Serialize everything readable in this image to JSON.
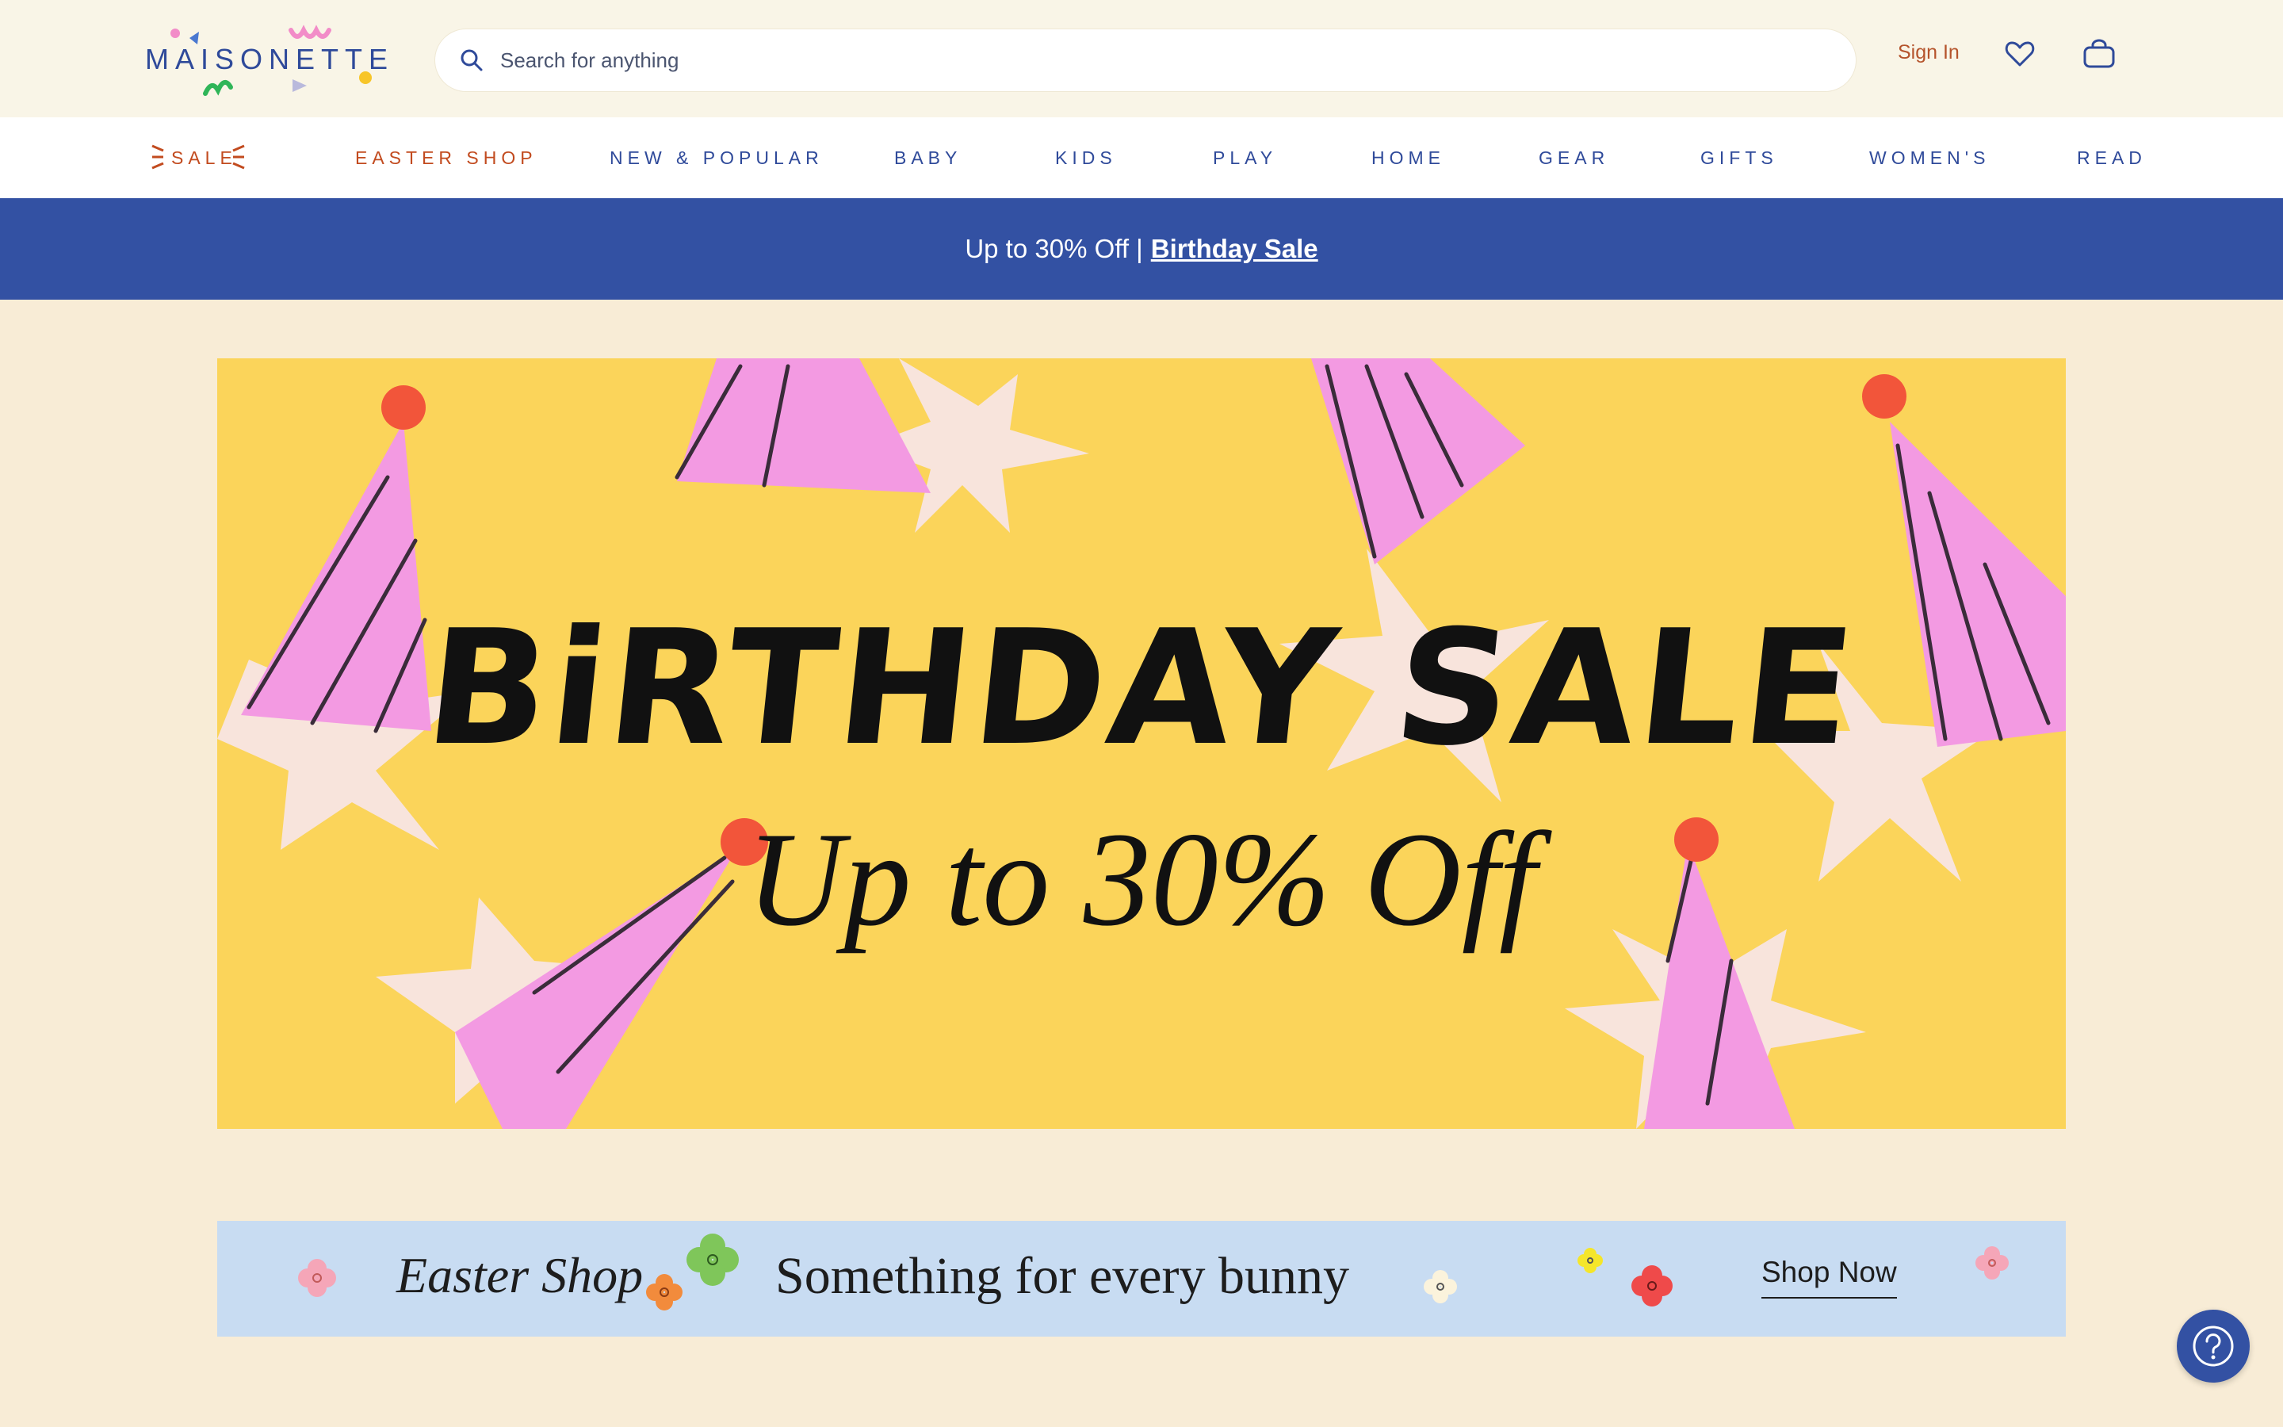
{
  "brand": {
    "logo_text": "MAISONETTE"
  },
  "search": {
    "placeholder": "Search for anything"
  },
  "header": {
    "sign_in": "Sign In",
    "wishlist_icon": "heart-icon",
    "cart_icon": "shopping-bag-icon"
  },
  "nav": {
    "items": [
      {
        "label": "SALE"
      },
      {
        "label": "EASTER SHOP"
      },
      {
        "label": "NEW & POPULAR"
      },
      {
        "label": "BABY"
      },
      {
        "label": "KIDS"
      },
      {
        "label": "PLAY"
      },
      {
        "label": "HOME"
      },
      {
        "label": "GEAR"
      },
      {
        "label": "GIFTS"
      },
      {
        "label": "WOMEN'S"
      },
      {
        "label": "READ"
      }
    ]
  },
  "promo": {
    "text": "Up to 30% Off |",
    "link": "Birthday Sale"
  },
  "hero": {
    "title": "BiRTHDAY SALE",
    "subtitle": "Up to 30% Off"
  },
  "easter_banner": {
    "title": "Easter Shop",
    "tagline": "Something for every bunny",
    "cta": "Shop Now"
  },
  "help": {
    "icon": "help-icon"
  },
  "colors": {
    "nav_blue": "#2f4a9a",
    "sale_orange": "#c24b1f",
    "promo_bg": "#3351a3",
    "hero_bg": "#fbd45a",
    "page_bg": "#f8ecd6",
    "easter_bg": "#c8dcf2"
  }
}
